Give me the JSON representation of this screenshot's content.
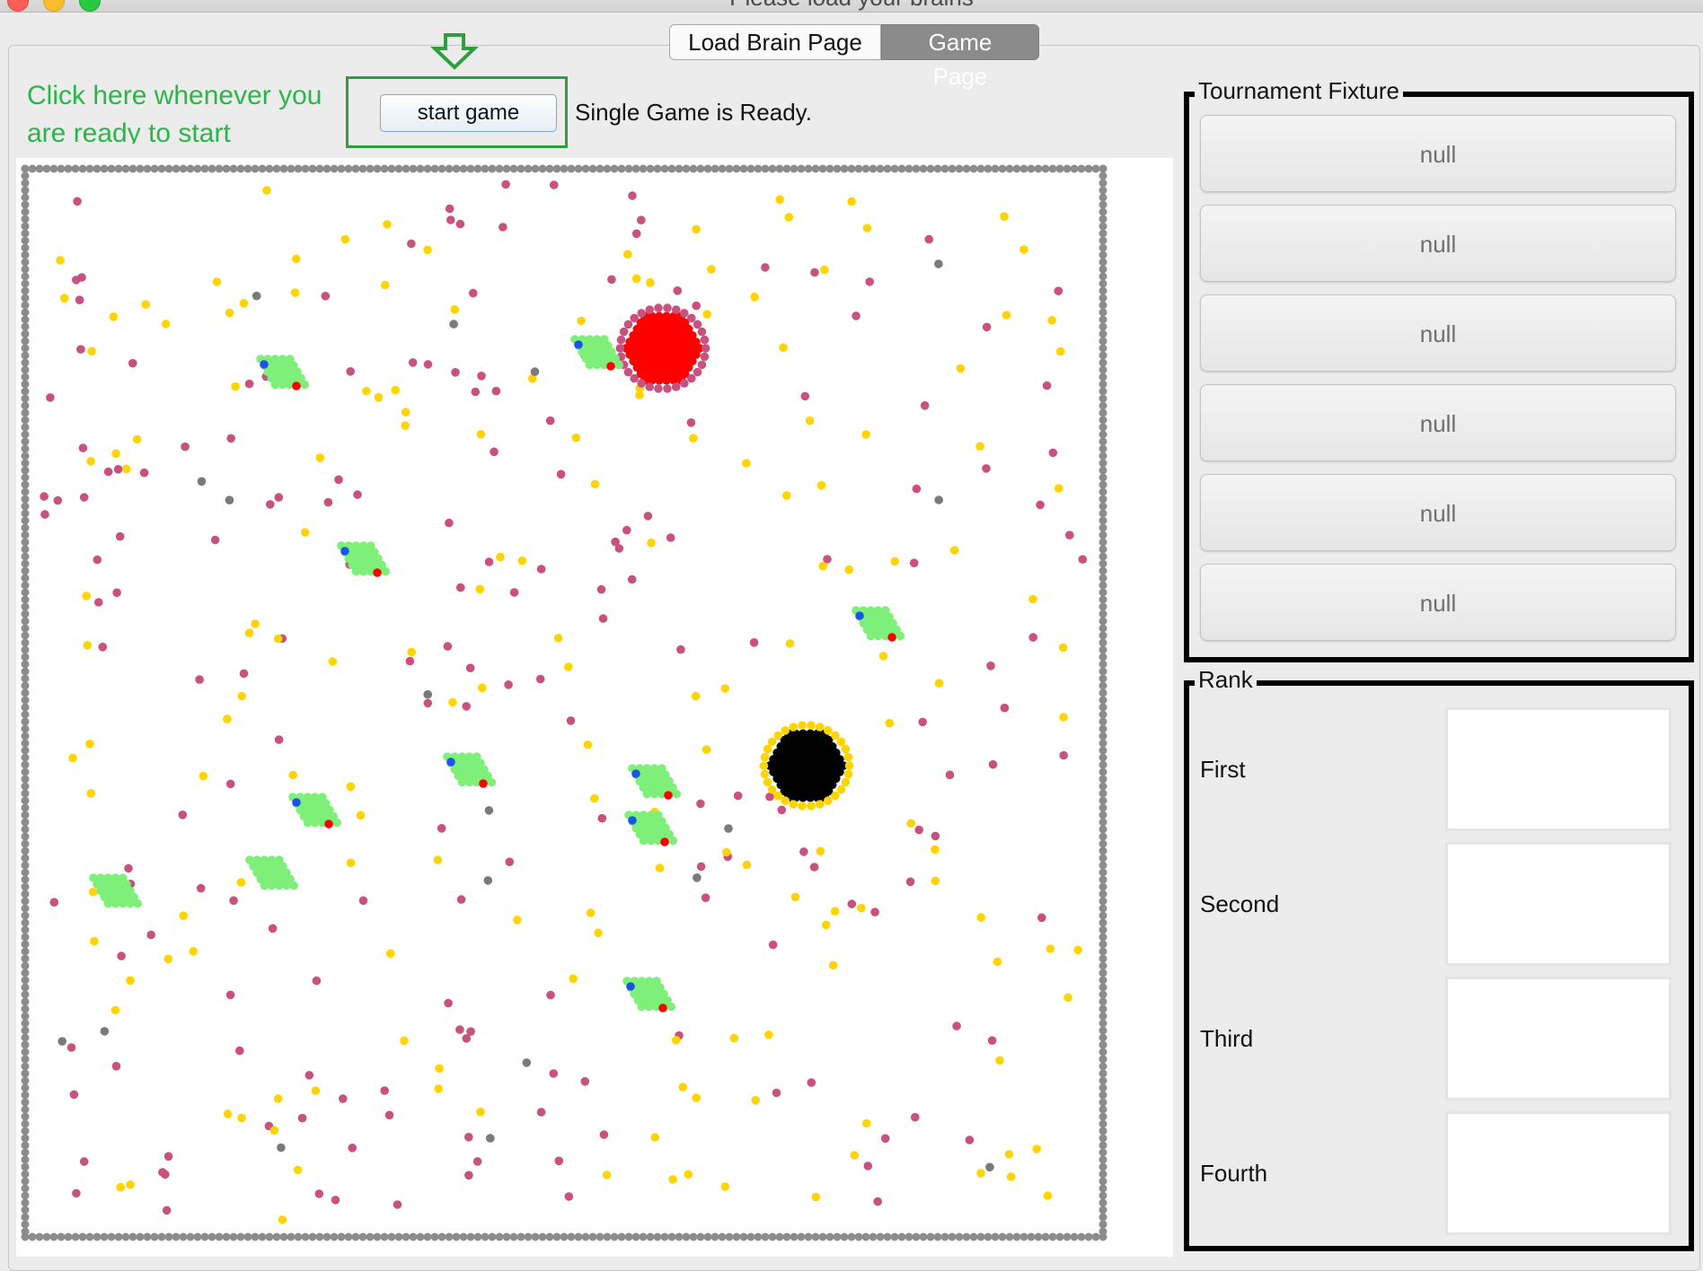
{
  "window": {
    "title": "Please load your brains"
  },
  "tabs": [
    {
      "label": "Load Brain Page",
      "active": false
    },
    {
      "label": "Game Page",
      "active": true
    }
  ],
  "hint": {
    "text": "Click here whenever you are ready to start",
    "color": "#2bb54a"
  },
  "controls": {
    "start_label": "start game",
    "status": "Single Game is Ready."
  },
  "fixture": {
    "title": "Tournament Fixture",
    "items": [
      "null",
      "null",
      "null",
      "null",
      "null",
      "null"
    ]
  },
  "rank": {
    "title": "Rank",
    "places": [
      {
        "label": "First",
        "value": ""
      },
      {
        "label": "Second",
        "value": ""
      },
      {
        "label": "Third",
        "value": ""
      },
      {
        "label": "Fourth",
        "value": ""
      }
    ]
  },
  "board": {
    "colors": {
      "food": "#ffd400",
      "marker": "#c9517f",
      "rock": "#7a7a7a",
      "red_ant": "#ff0000",
      "black_ant": "#000000",
      "grass": "#7ef07a",
      "blue_mark": "#1a55e6",
      "edge": "#8c8c8c"
    },
    "red_anthill": {
      "col": 89,
      "row": 24
    },
    "black_anthill": {
      "col": 108,
      "row": 81
    }
  }
}
